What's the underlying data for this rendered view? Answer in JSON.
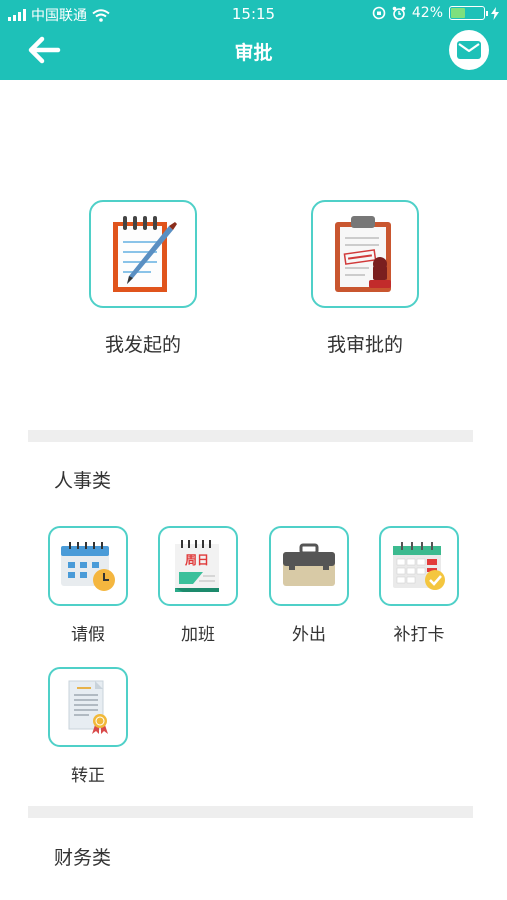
{
  "status_bar": {
    "carrier": "中国联通",
    "time": "15:15",
    "battery": "42%",
    "battery_level": 0.42
  },
  "nav": {
    "title": "审批",
    "back_icon": "arrow-left-icon",
    "mail_icon": "mail-icon"
  },
  "colors": {
    "accent": "#1ec1b8",
    "tile_border": "#4fd0c8",
    "divider": "#eeeeee"
  },
  "main_tiles": [
    {
      "label": "我发起的",
      "icon": "notepad-pen-icon"
    },
    {
      "label": "我审批的",
      "icon": "clipboard-stamp-icon"
    }
  ],
  "sections": [
    {
      "title": "人事类",
      "items": [
        {
          "label": "请假",
          "icon": "calendar-clock-icon"
        },
        {
          "label": "加班",
          "icon": "weekend-calendar-icon",
          "icon_text": "周日"
        },
        {
          "label": "外出",
          "icon": "briefcase-icon"
        },
        {
          "label": "补打卡",
          "icon": "calendar-check-icon"
        },
        {
          "label": "转正",
          "icon": "certificate-icon"
        }
      ]
    },
    {
      "title": "财务类",
      "items": []
    }
  ]
}
